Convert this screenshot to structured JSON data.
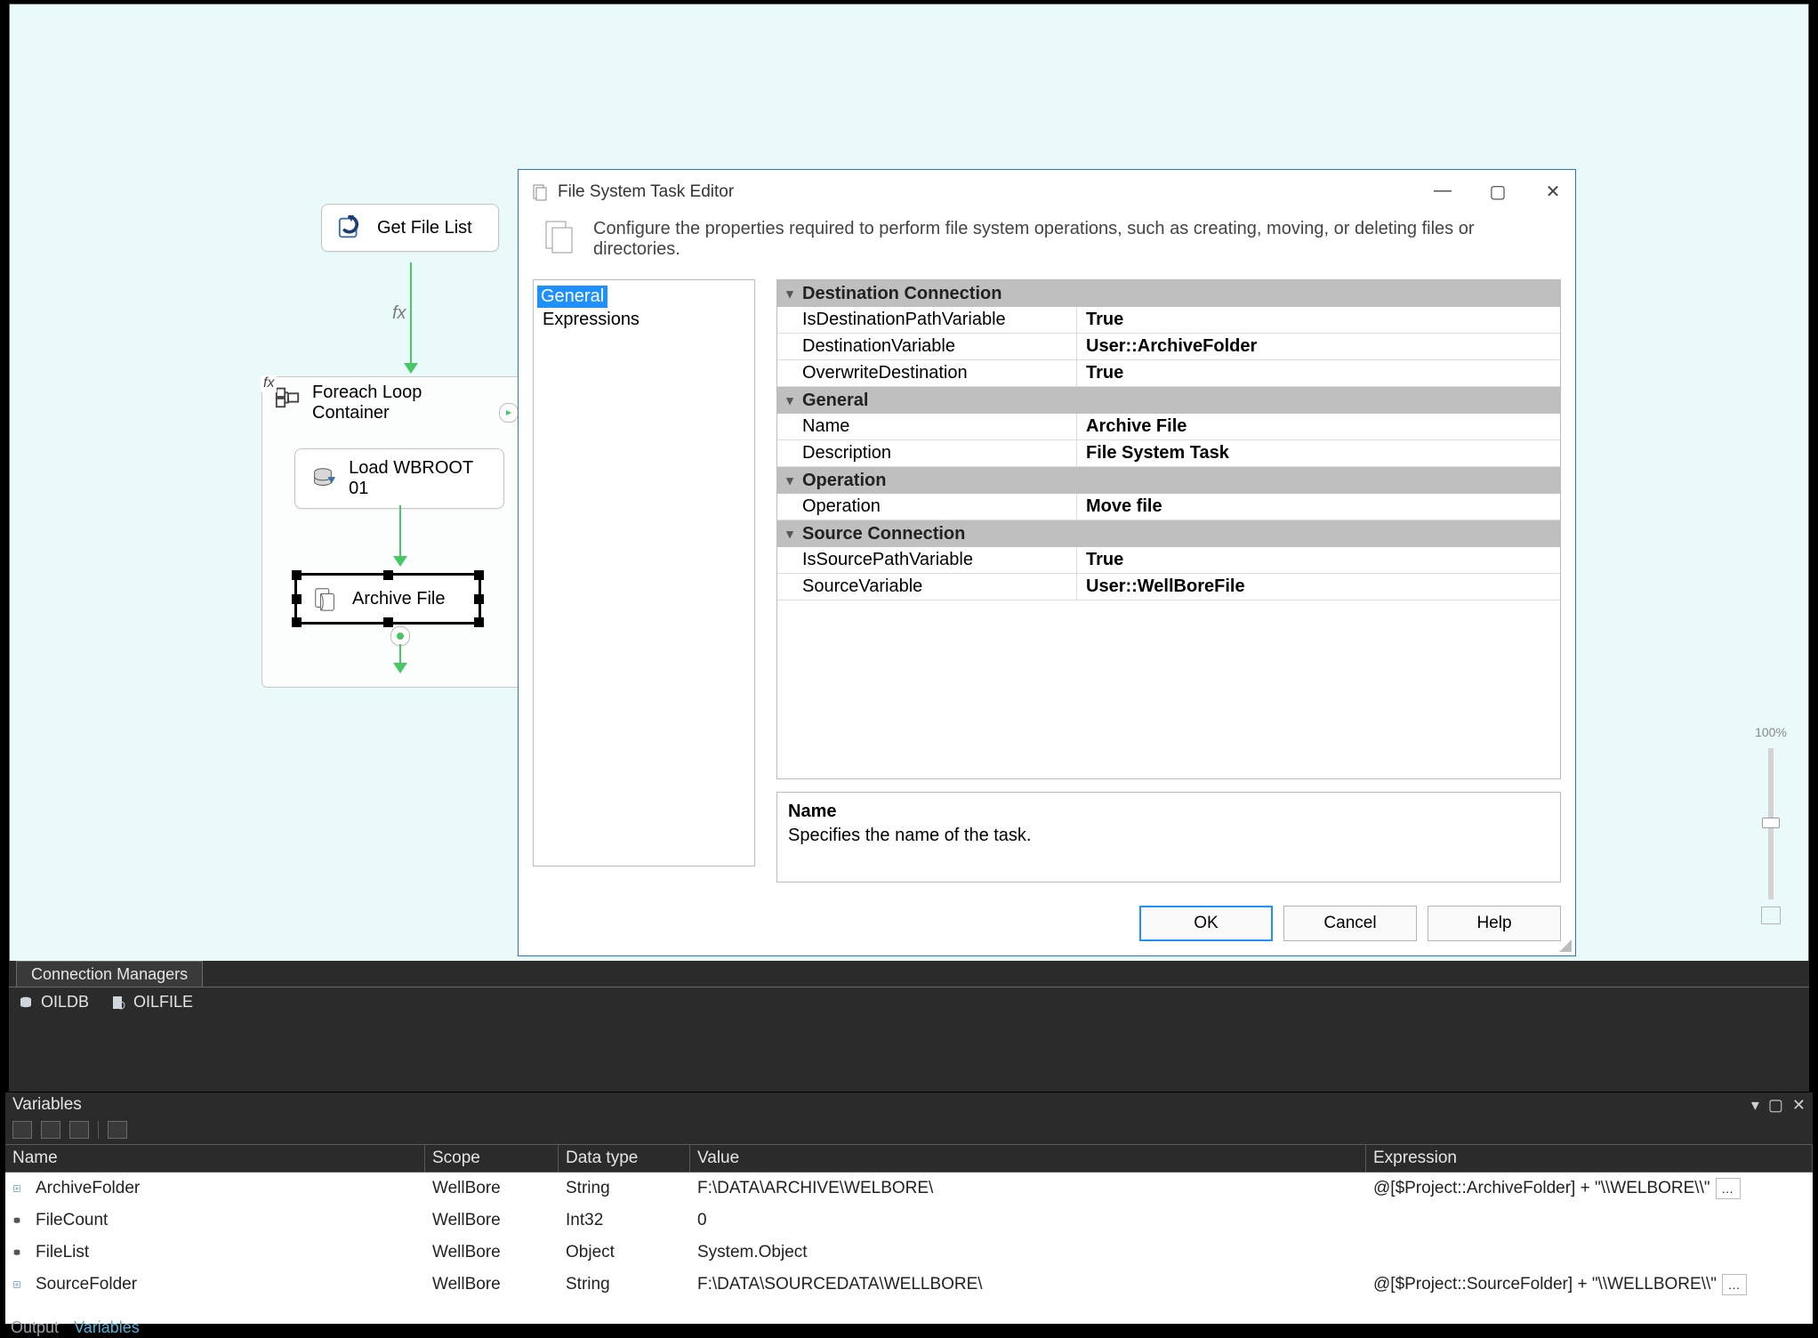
{
  "canvas": {
    "task_getfile": "Get File List",
    "loop_fx": "fx",
    "loop_label_l1": "Foreach Loop",
    "loop_label_l2": "Container",
    "task_load": "Load WBROOT 01",
    "task_archive": "Archive File",
    "arrow_fx": "fx"
  },
  "zoom": {
    "pct": "100%"
  },
  "connmgr": {
    "tab": "Connection Managers",
    "items": [
      "OILDB",
      "OILFILE"
    ]
  },
  "vars": {
    "title": "Variables",
    "headers": {
      "name": "Name",
      "scope": "Scope",
      "dt": "Data type",
      "value": "Value",
      "expr": "Expression"
    },
    "rows": [
      {
        "name": "ArchiveFolder",
        "scope": "WellBore",
        "dt": "String",
        "value": "F:\\DATA\\ARCHIVE\\WELBORE\\",
        "expr": "@[$Project::ArchiveFolder] + \"\\\\WELBORE\\\\\""
      },
      {
        "name": "FileCount",
        "scope": "WellBore",
        "dt": "Int32",
        "value": "0",
        "expr": ""
      },
      {
        "name": "FileList",
        "scope": "WellBore",
        "dt": "Object",
        "value": "System.Object",
        "expr": ""
      },
      {
        "name": "SourceFolder",
        "scope": "WellBore",
        "dt": "String",
        "value": "F:\\DATA\\SOURCEDATA\\WELLBORE\\",
        "expr": "@[$Project::SourceFolder] + \"\\\\WELLBORE\\\\\""
      }
    ]
  },
  "bottom_tabs": {
    "output": "Output",
    "variables": "Variables"
  },
  "dialog": {
    "title": "File System Task Editor",
    "subtitle": "Configure the properties required to perform file system operations, such as creating, moving, or deleting files or directories.",
    "nav": {
      "general": "General",
      "expressions": "Expressions"
    },
    "cats": {
      "dest": "Destination Connection",
      "gen": "General",
      "op": "Operation",
      "src": "Source Connection"
    },
    "props": {
      "isDestVar": {
        "n": "IsDestinationPathVariable",
        "v": "True"
      },
      "destVar": {
        "n": "DestinationVariable",
        "v": "User::ArchiveFolder"
      },
      "overwrite": {
        "n": "OverwriteDestination",
        "v": "True"
      },
      "name": {
        "n": "Name",
        "v": "Archive File"
      },
      "desc": {
        "n": "Description",
        "v": "File System Task"
      },
      "op": {
        "n": "Operation",
        "v": "Move file"
      },
      "isSrcVar": {
        "n": "IsSourcePathVariable",
        "v": "True"
      },
      "srcVar": {
        "n": "SourceVariable",
        "v": "User::WellBoreFile"
      }
    },
    "help": {
      "name": "Name",
      "desc": "Specifies the name of the task."
    },
    "buttons": {
      "ok": "OK",
      "cancel": "Cancel",
      "help": "Help"
    }
  }
}
